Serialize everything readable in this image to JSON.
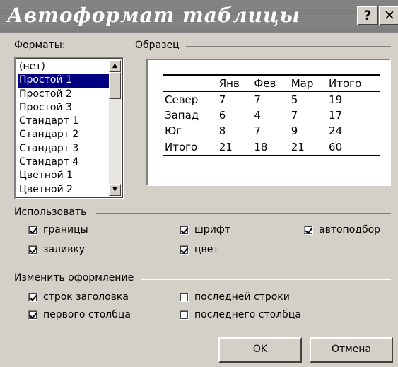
{
  "window": {
    "title": "Автоформат таблицы",
    "help_label": "?",
    "close_label": "✕"
  },
  "formats": {
    "label": "Форматы:",
    "items": [
      "(нет)",
      "Простой 1",
      "Простой 2",
      "Простой 3",
      "Стандарт 1",
      "Стандарт 2",
      "Стандарт 3",
      "Стандарт 4",
      "Цветной 1",
      "Цветной 2"
    ],
    "selected": "Простой 1"
  },
  "preview": {
    "label": "Образец",
    "header": [
      "",
      "Янв",
      "Фев",
      "Мар",
      "Итого"
    ],
    "rows": [
      [
        "Север",
        "7",
        "7",
        "5",
        "19"
      ],
      [
        "Запад",
        "6",
        "4",
        "7",
        "17"
      ],
      [
        "Юг",
        "8",
        "7",
        "9",
        "24"
      ],
      [
        "Итого",
        "21",
        "18",
        "21",
        "60"
      ]
    ]
  },
  "use_group": {
    "label": "Использовать",
    "borders": {
      "label": "границы",
      "checked": true
    },
    "shading": {
      "label": "заливку",
      "checked": true
    },
    "font": {
      "label": "шрифт",
      "checked": true
    },
    "color": {
      "label": "цвет",
      "checked": true
    },
    "autofit": {
      "label": "автоподбор",
      "checked": true
    }
  },
  "modify_group": {
    "label": "Изменить оформление",
    "header_rows": {
      "label": "строк заголовка",
      "checked": true
    },
    "first_column": {
      "label": "первого столбца",
      "checked": true
    },
    "last_row": {
      "label": "последней строки",
      "checked": false
    },
    "last_column": {
      "label": "последнего столбца",
      "checked": false
    }
  },
  "buttons": {
    "ok": "OK",
    "cancel": "Отмена"
  }
}
